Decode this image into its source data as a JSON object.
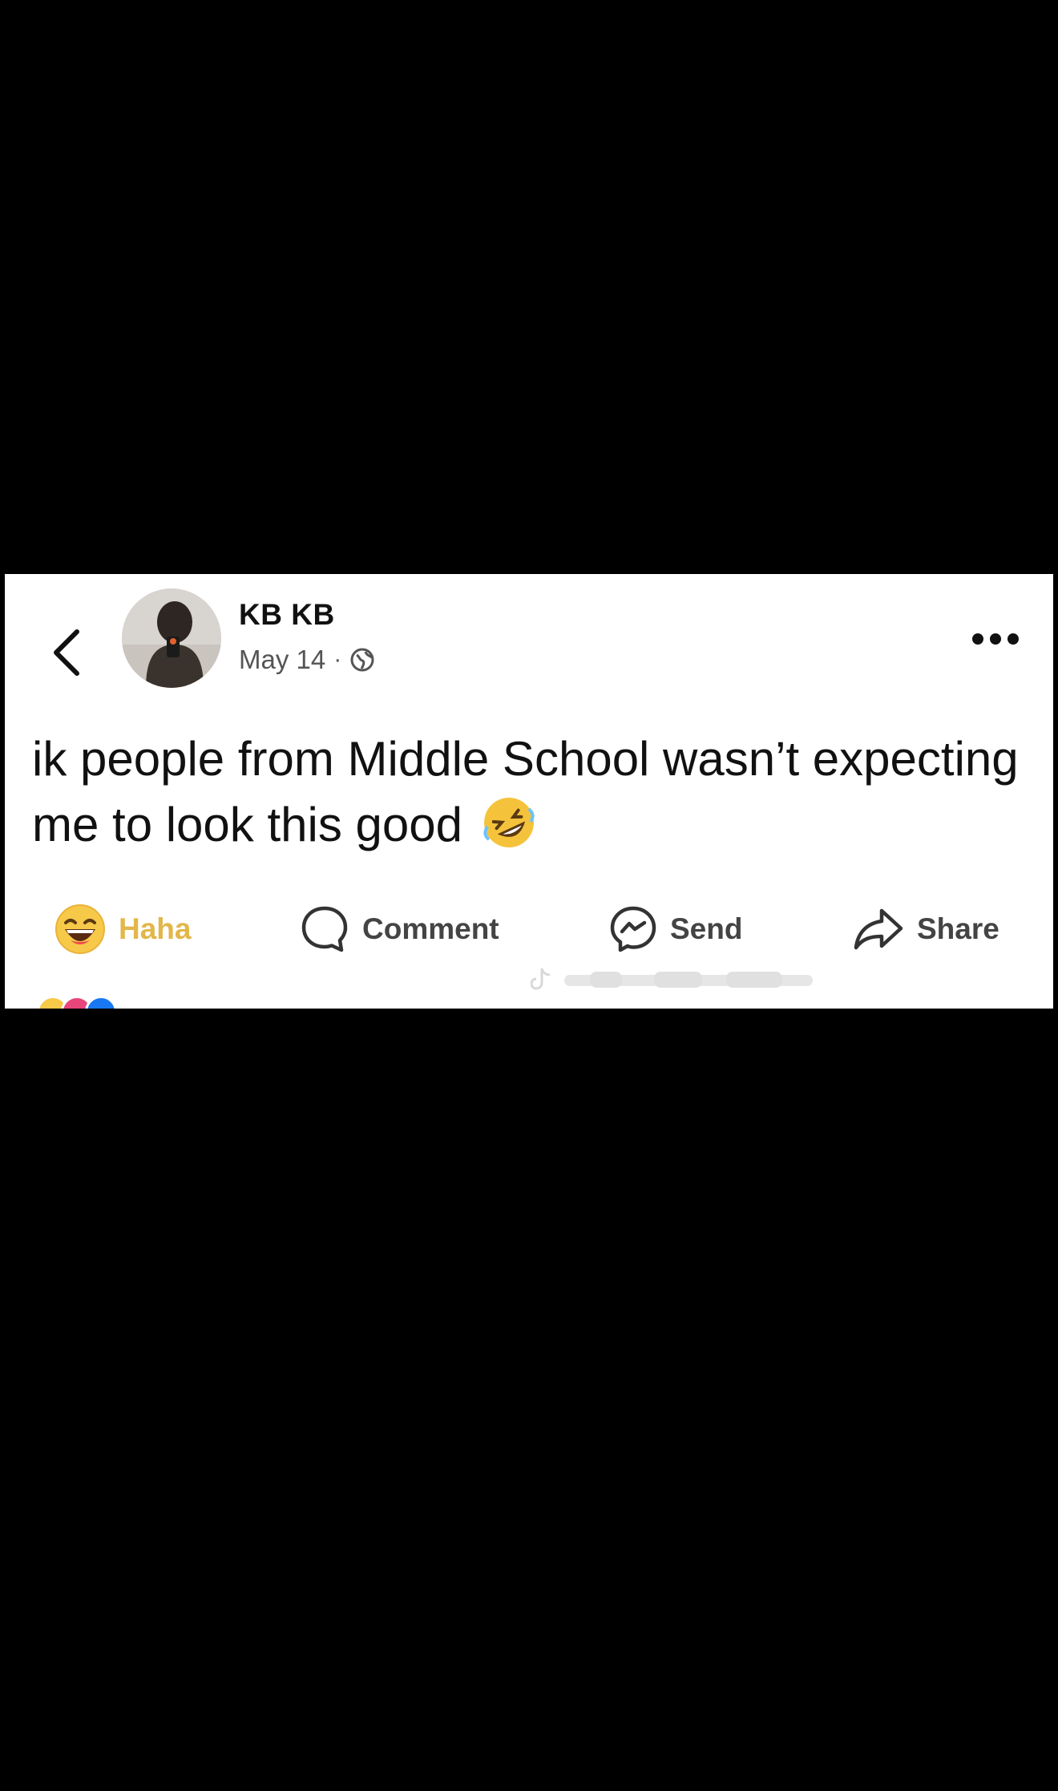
{
  "post": {
    "author": "KB KB",
    "date": "May 14",
    "separator": "·",
    "privacy_icon": "globe-icon",
    "text": "ik people from Middle School wasn’t expecting me to look this good",
    "text_emoji_icon": "rolling-on-floor-laughing-emoji"
  },
  "actions": {
    "haha_label": "Haha",
    "comment_label": "Comment",
    "send_label": "Send",
    "share_label": "Share"
  },
  "icons": {
    "back": "chevron-left-icon",
    "more": "more-dots-icon",
    "haha": "haha-emoji-icon",
    "comment": "comment-bubble-icon",
    "send": "messenger-icon",
    "share": "share-arrow-icon"
  },
  "colors": {
    "haha_accent": "#e2b74a",
    "card_background": "#ffffff",
    "page_background": "#000000"
  }
}
